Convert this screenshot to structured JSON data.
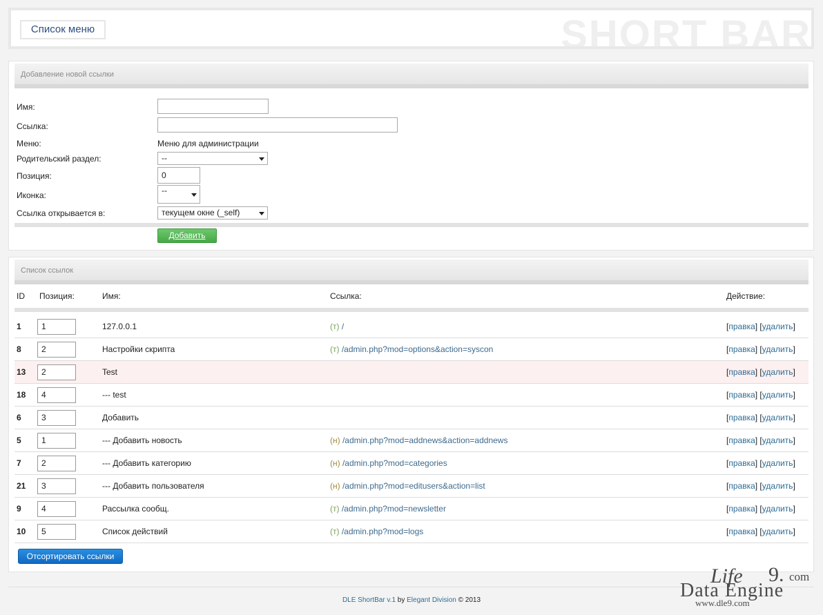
{
  "header": {
    "menu_button": "Список меню",
    "watermark": "SHORT BAR"
  },
  "add_form": {
    "title": "Добавление новой ссылки",
    "labels": {
      "name": "Имя:",
      "link": "Ссылка:",
      "menu": "Меню:",
      "parent": "Родительский раздел:",
      "position": "Позиция:",
      "icon": "Иконка:",
      "target": "Ссылка открывается в:"
    },
    "values": {
      "name": "",
      "link": "",
      "menu": "Меню для администрации",
      "parent": "--",
      "position": "0",
      "icon": "--",
      "target": "текущем окне (_self)"
    },
    "submit": "Добавить"
  },
  "links_list": {
    "title": "Список ссылок",
    "columns": {
      "id": "ID",
      "position": "Позиция:",
      "name": "Имя:",
      "link": "Ссылка:",
      "action": "Действие:"
    },
    "edit_label": "правка",
    "delete_label": "удалить",
    "rows": [
      {
        "id": "1",
        "position": "1",
        "name": "127.0.0.1",
        "tag": "(т)",
        "link": "/"
      },
      {
        "id": "8",
        "position": "2",
        "name": "Настройки скрипта",
        "tag": "(т)",
        "link": "/admin.php?mod=options&action=syscon"
      },
      {
        "id": "13",
        "position": "2",
        "name": "Test",
        "tag": "",
        "link": ""
      },
      {
        "id": "18",
        "position": "4",
        "name": "--- test",
        "tag": "",
        "link": ""
      },
      {
        "id": "6",
        "position": "3",
        "name": "Добавить",
        "tag": "",
        "link": ""
      },
      {
        "id": "5",
        "position": "1",
        "name": "--- Добавить новость",
        "tag": "(н)",
        "link": "/admin.php?mod=addnews&action=addnews"
      },
      {
        "id": "7",
        "position": "2",
        "name": "--- Добавить категорию",
        "tag": "(н)",
        "link": "/admin.php?mod=categories"
      },
      {
        "id": "21",
        "position": "3",
        "name": "--- Добавить пользователя",
        "tag": "(н)",
        "link": "/admin.php?mod=editusers&action=list"
      },
      {
        "id": "9",
        "position": "4",
        "name": "Рассылка сообщ.",
        "tag": "(т)",
        "link": "/admin.php?mod=newsletter"
      },
      {
        "id": "10",
        "position": "5",
        "name": "Список действий",
        "tag": "(т)",
        "link": "/admin.php?mod=logs"
      }
    ],
    "sort_button": "Отсортировать ссылки"
  },
  "footer": {
    "product": "DLE ShortBar v.1",
    "by": "by",
    "author": "Elegant Division",
    "copyright": "© 2013"
  },
  "logo": {
    "line1": "Life",
    "nine": "9.",
    "com": "com",
    "line2": "Data Engine",
    "url": "www.dle9.com"
  },
  "colors": {
    "link_blue": "#3e6a8e",
    "highlight_row": "#fdf0f0",
    "green_button": "#46a846",
    "blue_button": "#0f69c3"
  }
}
